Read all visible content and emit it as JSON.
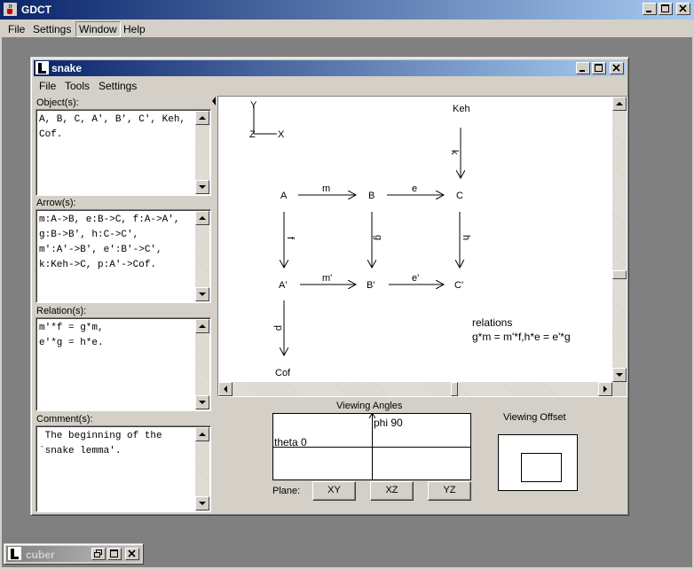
{
  "app": {
    "title": "GDCT",
    "menu": [
      "File",
      "Settings",
      "Window",
      "Help"
    ]
  },
  "snake": {
    "title": "snake",
    "menu": [
      "File",
      "Tools",
      "Settings"
    ],
    "objects_label": "Object(s):",
    "objects_text": "A, B, C, A', B', C', Keh,\nCof.",
    "arrows_label": "Arrow(s):",
    "arrows_text": "m:A->B, e:B->C, f:A->A',\ng:B->B', h:C->C',\nm':A'->B', e':B'->C',\nk:Keh->C, p:A'->Cof.",
    "relations_label": "Relation(s):",
    "relations_text": "m'*f = g*m,\ne'*g = h*e.",
    "comments_label": "Comment(s):",
    "comments_text": " The beginning of the\n`snake lemma'.",
    "diagram": {
      "axes": {
        "y": "Y",
        "z": "Z",
        "x": "X"
      },
      "nodes": {
        "keh": "Keh",
        "a": "A",
        "b": "B",
        "c": "C",
        "a2": "A'",
        "b2": "B'",
        "c2": "C'",
        "cof": "Cof"
      },
      "arrow_labels": {
        "m": "m",
        "e": "e",
        "k": "k",
        "f": "f",
        "g": "g",
        "h": "h",
        "m2": "m'",
        "e2": "e'",
        "p": "p"
      },
      "relations_title": "relations",
      "relations_text": "g*m = m'*f,h*e = e'*g"
    },
    "viewing_angles_label": "Viewing Angles",
    "phi_label": "phi 90",
    "theta_label": "theta 0",
    "viewing_offset_label": "Viewing Offset",
    "plane_label": "Plane:",
    "plane_buttons": [
      "XY",
      "XZ",
      "YZ"
    ]
  },
  "cuber": {
    "title": "cuber"
  }
}
